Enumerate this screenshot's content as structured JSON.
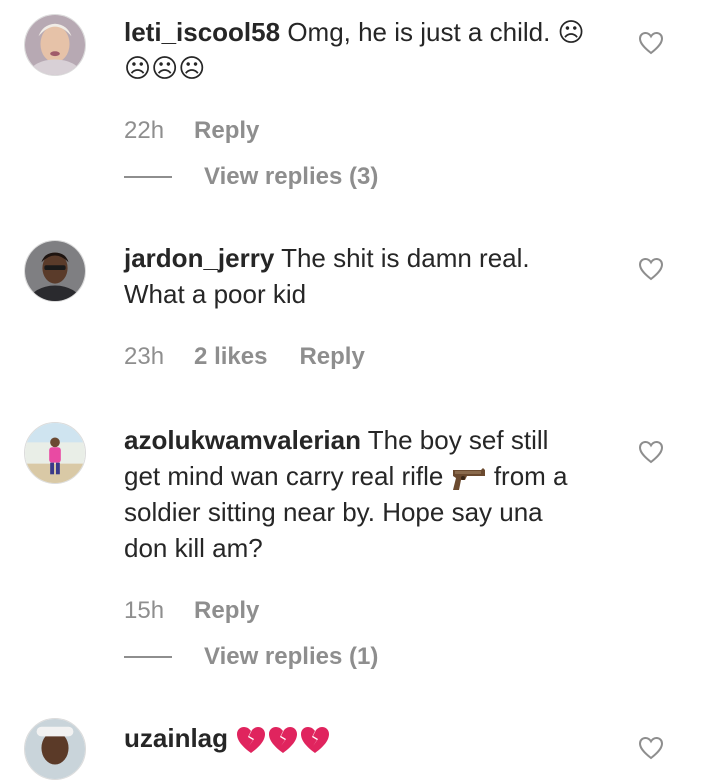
{
  "comments": [
    {
      "username": "leti_iscool58",
      "text": "Omg, he is just a child. ☹",
      "text_line2": "☹☹☹",
      "time": "22h",
      "reply_label": "Reply",
      "view_replies_label": "View replies (3)"
    },
    {
      "username": "jardon_jerry",
      "text": "The shit is damn real.",
      "text_line2": "What a poor kid",
      "time": "23h",
      "likes_label": "2 likes",
      "reply_label": "Reply"
    },
    {
      "username": "azolukwamvalerian",
      "text_line1": "The boy sef still",
      "text_line2a": "get mind wan carry real rifle",
      "text_line2b": "from a",
      "text_line3": "soldier sitting near by. Hope say una",
      "text_line4": "don kill am?",
      "emoji": "pistol-icon",
      "time": "15h",
      "reply_label": "Reply",
      "view_replies_label": "View replies (1)"
    },
    {
      "username": "uzainlag",
      "emoji": "broken-heart-icon",
      "emoji_count": 3
    }
  ],
  "colors": {
    "text": "#262626",
    "secondary": "#8e8e8e",
    "broken_heart": "#e0245e"
  }
}
